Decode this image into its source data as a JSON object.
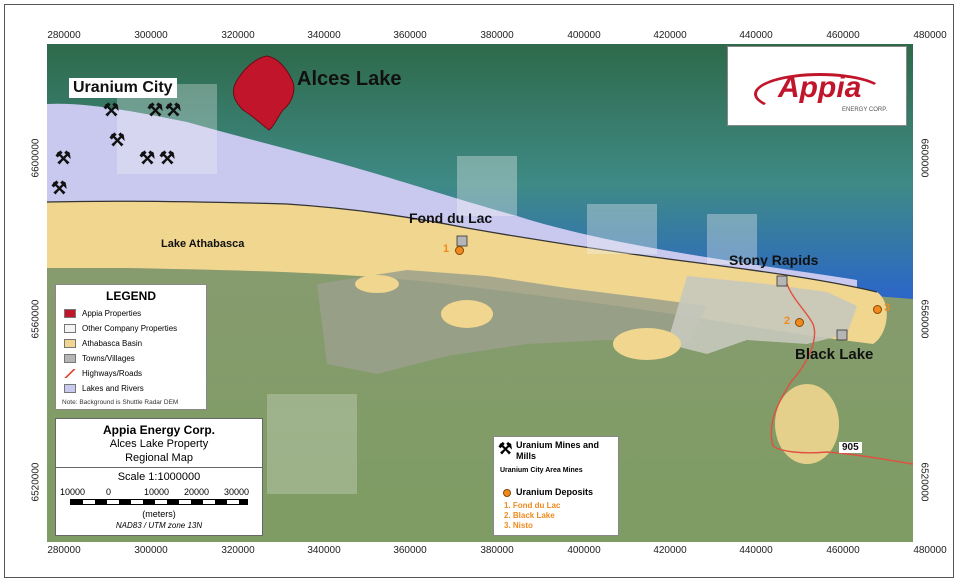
{
  "x_ticks": [
    "280000",
    "300000",
    "320000",
    "340000",
    "360000",
    "380000",
    "400000",
    "420000",
    "440000",
    "460000",
    "480000"
  ],
  "y_ticks": [
    "6600000",
    "6560000",
    "6520000"
  ],
  "places": {
    "uranium_city": "Uranium City",
    "alces_lake": "Alces Lake",
    "fond_du_lac": "Fond du Lac",
    "lake_athabasca": "Lake Athabasca",
    "stony_rapids": "Stony Rapids",
    "black_lake": "Black Lake",
    "highway_number": "905"
  },
  "logo": {
    "brand": "Appia",
    "sub": "ENERGY CORP."
  },
  "legend": {
    "title": "LEGEND",
    "items": [
      {
        "label": "Appia Properties",
        "color": "#c0152a"
      },
      {
        "label": "Other Company Properties",
        "color": "#f4f4f4"
      },
      {
        "label": "Athabasca Basin",
        "color": "#f0d68f"
      },
      {
        "label": "Towns/Villages",
        "color": "#b5b5b5"
      },
      {
        "label": "Highways/Roads",
        "color": "#e05040"
      },
      {
        "label": "Lakes and Rivers",
        "color": "#c9c9f0"
      }
    ],
    "note": "Note: Background is Shuttle Radar DEM"
  },
  "title_block": {
    "company": "Appia Energy Corp.",
    "property": "Alces Lake Property",
    "map_type": "Regional Map",
    "scale": "Scale 1:1000000",
    "scale_labels": [
      "10000",
      "0",
      "10000",
      "20000",
      "30000"
    ],
    "units": "(meters)",
    "projection": "NAD83 / UTM zone 13N"
  },
  "mines_legend": {
    "mines_label": "Uranium Mines and Mills",
    "mines_sub": "Uranium City Area Mines",
    "deposits_label": "Uranium Deposits",
    "deposits": [
      "1. Fond du Lac",
      "2. Black Lake",
      "3. Nisto"
    ]
  },
  "deposit_markers": [
    "1",
    "2",
    "3"
  ],
  "colors": {
    "appia": "#c0152a",
    "deposit": "#f08a1e",
    "basin": "#f0d68f",
    "lake": "#c9c9f0",
    "road": "#e05040"
  }
}
